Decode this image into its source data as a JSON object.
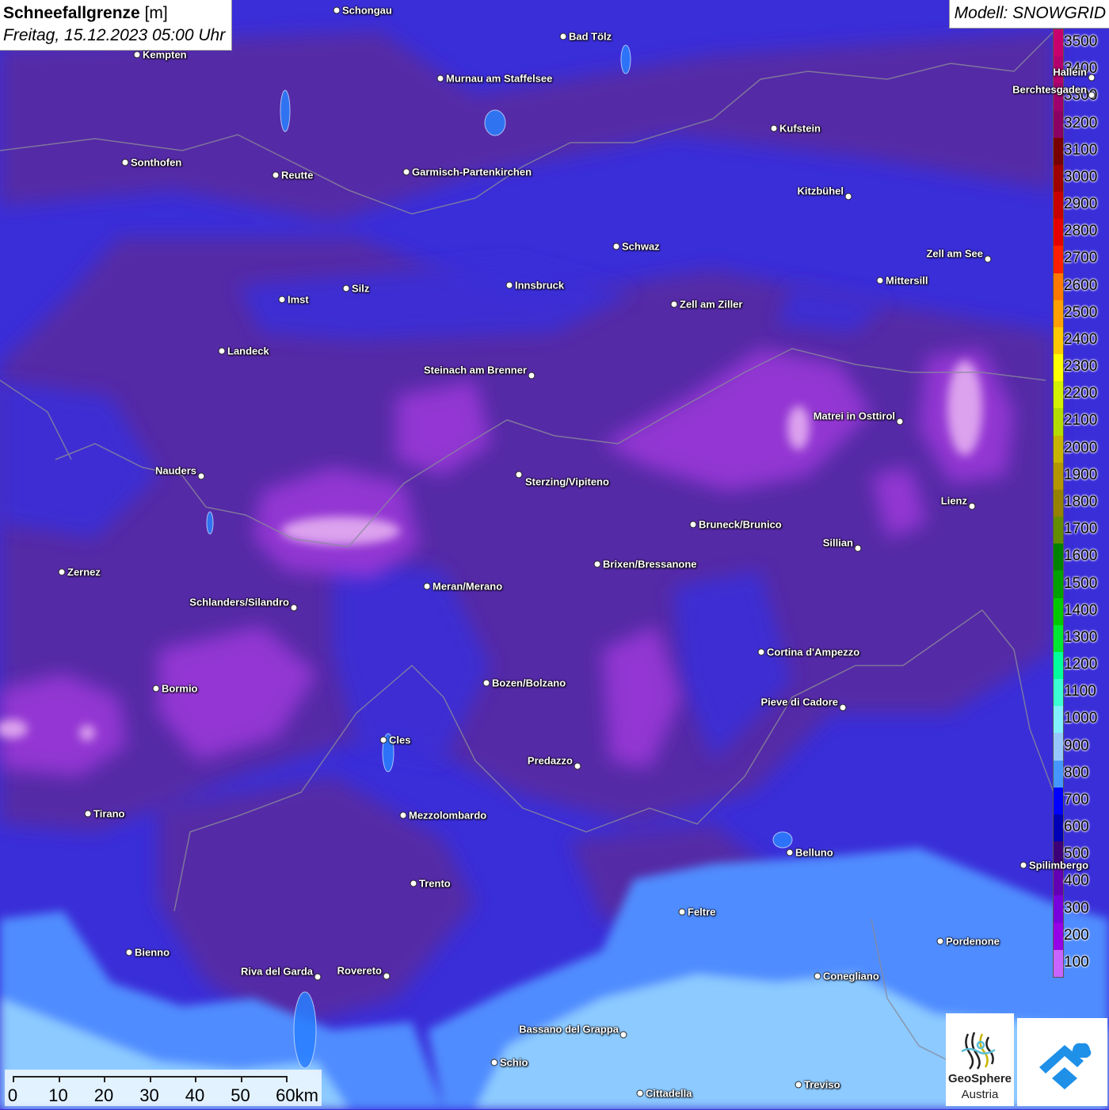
{
  "header": {
    "title": "Schneefallgrenze",
    "unit": "[m]",
    "datetime": "Freitag, 15.12.2023 05:00 Uhr",
    "model": "Modell: SNOWGRID"
  },
  "legend": {
    "labels": [
      "3500",
      "3400",
      "3300",
      "3200",
      "3100",
      "3000",
      "2900",
      "2800",
      "2700",
      "2600",
      "2500",
      "2400",
      "2300",
      "2200",
      "2100",
      "2000",
      "1900",
      "1800",
      "1700",
      "1600",
      "1500",
      "1400",
      "1300",
      "1200",
      "1100",
      "1000",
      "900",
      "800",
      "700",
      "600",
      "500",
      "400",
      "300",
      "200",
      "100"
    ],
    "colors": [
      "#c8006e",
      "#b4006e",
      "#a0006e",
      "#8c0064",
      "#780000",
      "#a00000",
      "#c80000",
      "#e60000",
      "#ff1e00",
      "#ff7800",
      "#ffa000",
      "#ffc800",
      "#ffff00",
      "#d2f000",
      "#b4dc00",
      "#c8b400",
      "#b49600",
      "#968200",
      "#648c00",
      "#008200",
      "#00a000",
      "#00c800",
      "#00e632",
      "#00ff9c",
      "#3cffd2",
      "#82f0ff",
      "#96c8ff",
      "#4696ff",
      "#0000ff",
      "#0000b4",
      "#3c0078",
      "#6400b4",
      "#7800dc",
      "#9600e6",
      "#c864ff"
    ]
  },
  "cities": [
    {
      "name": "Schongau"
    },
    {
      "name": "Bad Tölz"
    },
    {
      "name": "Kempten"
    },
    {
      "name": "Murnau am Staffelsee"
    },
    {
      "name": "Berchtesgaden"
    },
    {
      "name": "Hallein"
    },
    {
      "name": "Kufstein"
    },
    {
      "name": "Sonthofen"
    },
    {
      "name": "Reutte"
    },
    {
      "name": "Garmisch-Partenkirchen"
    },
    {
      "name": "Kitzbühel"
    },
    {
      "name": "Schwaz"
    },
    {
      "name": "Zell am See"
    },
    {
      "name": "Mittersill"
    },
    {
      "name": "Innsbruck"
    },
    {
      "name": "Imst"
    },
    {
      "name": "Silz"
    },
    {
      "name": "Zell am Ziller"
    },
    {
      "name": "Landeck"
    },
    {
      "name": "Steinach am Brenner"
    },
    {
      "name": "Matrei in Osttirol"
    },
    {
      "name": "Nauders"
    },
    {
      "name": "Sterzing/Vipiteno"
    },
    {
      "name": "Lienz"
    },
    {
      "name": "Bruneck/Brunico"
    },
    {
      "name": "Sillian"
    },
    {
      "name": "Brixen/Bressanone"
    },
    {
      "name": "Zernez"
    },
    {
      "name": "Meran/Merano"
    },
    {
      "name": "Schlanders/Silandro"
    },
    {
      "name": "Cortina d'Ampezzo"
    },
    {
      "name": "Bozen/Bolzano"
    },
    {
      "name": "Bormio"
    },
    {
      "name": "Pieve di Cadore"
    },
    {
      "name": "Cles"
    },
    {
      "name": "Predazzo"
    },
    {
      "name": "Tirano"
    },
    {
      "name": "Mezzolombardo"
    },
    {
      "name": "Belluno"
    },
    {
      "name": "Spilimbergo"
    },
    {
      "name": "Trento"
    },
    {
      "name": "Feltre"
    },
    {
      "name": "Pordenone"
    },
    {
      "name": "Bienno"
    },
    {
      "name": "Riva del Garda"
    },
    {
      "name": "Rovereto"
    },
    {
      "name": "Conegliano"
    },
    {
      "name": "Bassano del Grappa"
    },
    {
      "name": "Schio"
    },
    {
      "name": "Treviso"
    },
    {
      "name": "Cittadella"
    }
  ],
  "scalebar": {
    "labels": [
      "0",
      "10",
      "20",
      "30",
      "40",
      "50",
      "60km"
    ]
  },
  "logo": {
    "line1": "GeoSphere",
    "line2": "Austria"
  }
}
